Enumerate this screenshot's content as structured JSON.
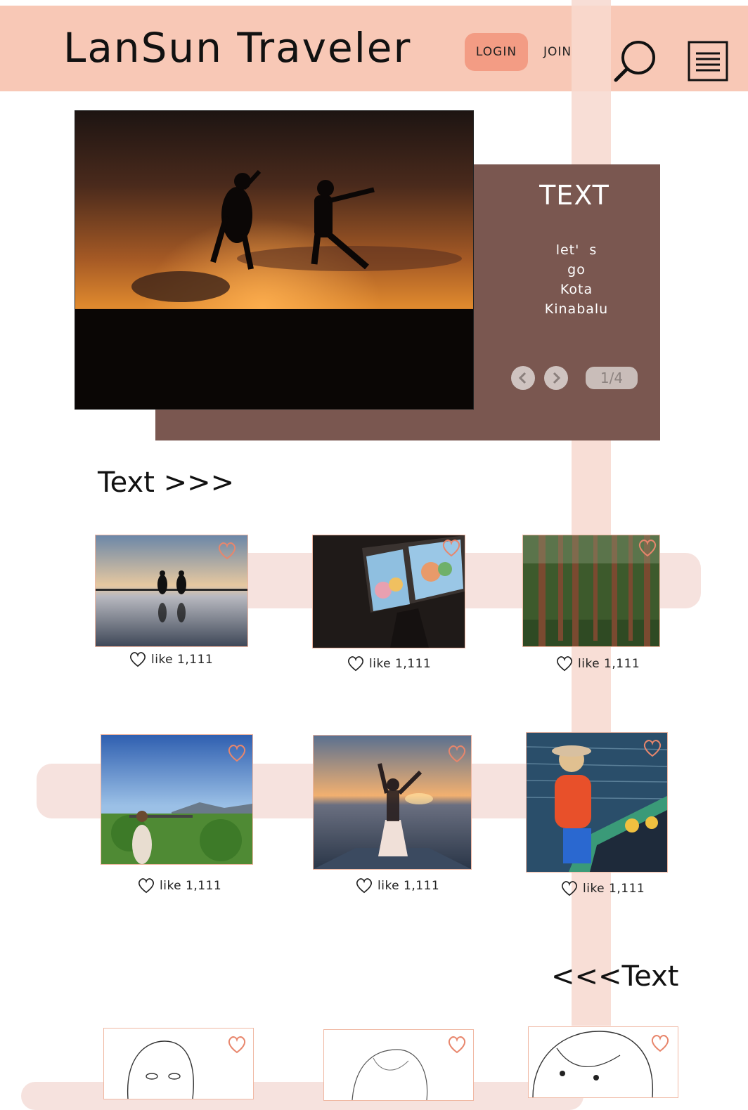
{
  "header": {
    "logo": "LanSun Traveler",
    "login_label": "LOGIN",
    "join_label": "JOIN"
  },
  "hero": {
    "title": "TEXT",
    "subtitle": "let'  s\ngo\nKota\nKinabalu",
    "pager": "1/4"
  },
  "sections": {
    "first_title": "Text >>>",
    "second_title": "<<<Text"
  },
  "gallery": [
    {
      "like": "like 1,111"
    },
    {
      "like": "like 1,111"
    },
    {
      "like": "like 1,111"
    },
    {
      "like": "like 1,111"
    },
    {
      "like": "like 1,111"
    },
    {
      "like": "like 1,111"
    }
  ],
  "colors": {
    "header_bg": "#f8c8b6",
    "login_bg": "#f39c84",
    "hero_panel": "#7a5750",
    "band": "#f6e2de",
    "heart": "#e8866c"
  }
}
